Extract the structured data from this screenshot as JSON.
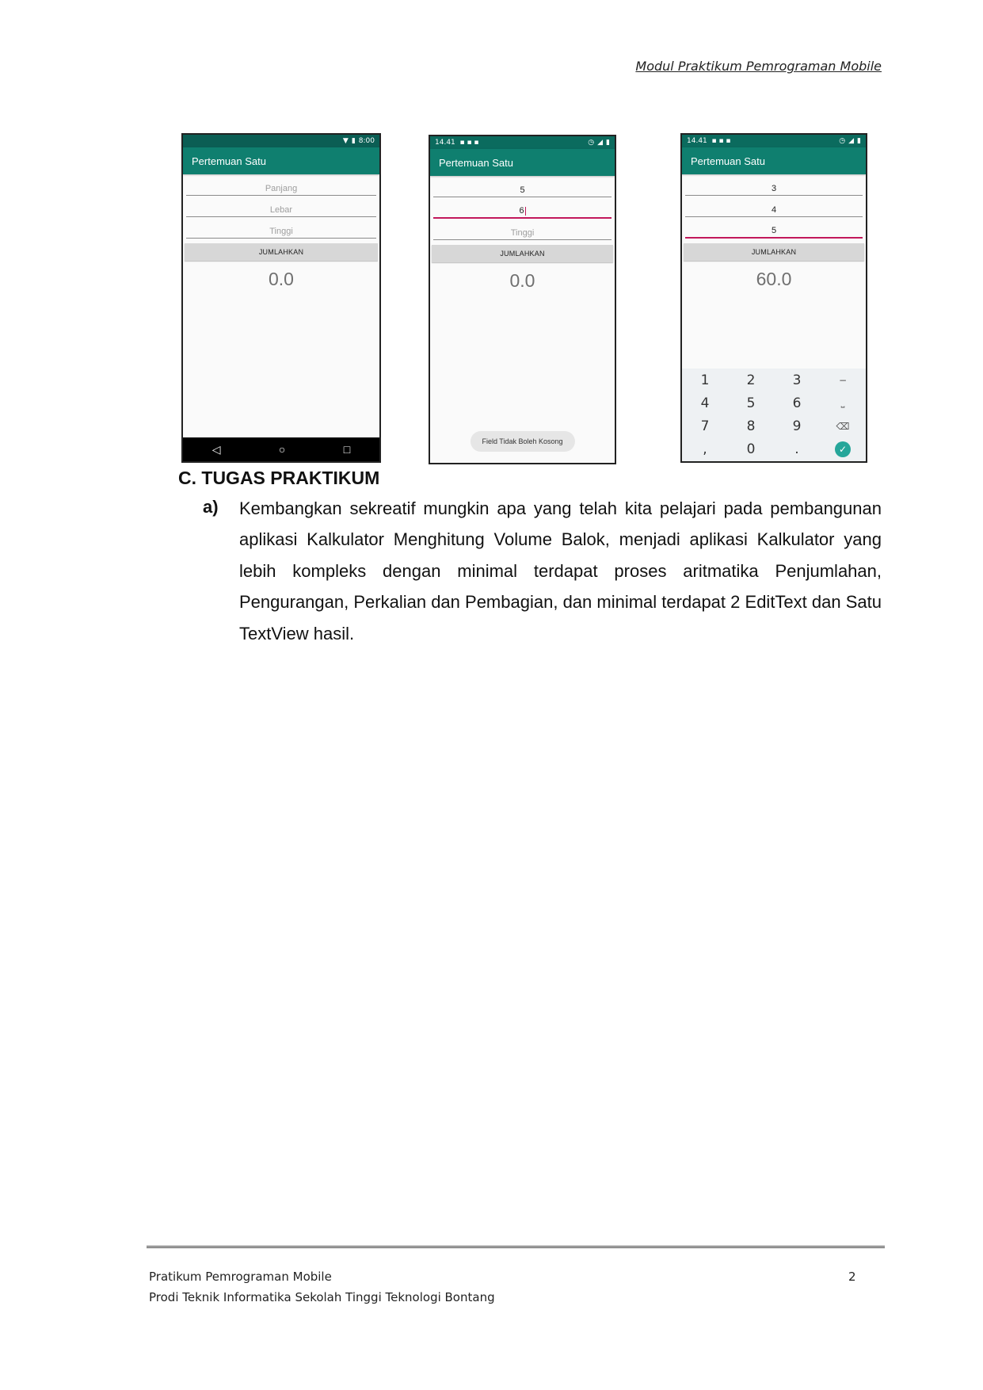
{
  "header": {
    "title": "Modul Praktikum Pemrograman Mobile"
  },
  "phones": [
    {
      "status_time": "8:00",
      "app_title": "Pertemuan Satu",
      "fields": [
        "Panjang",
        "Lebar",
        "Tinggi"
      ],
      "button": "JUMLAHKAN",
      "result": "0.0",
      "nav": {
        "back": "◁",
        "home": "○",
        "recent": "□"
      }
    },
    {
      "status_time": "14.41",
      "app_title": "Pertemuan Satu",
      "fields": [
        "5",
        "6",
        "Tinggi"
      ],
      "button": "JUMLAHKAN",
      "result": "0.0",
      "toast": "Field Tidak Boleh Kosong"
    },
    {
      "status_time": "14.41",
      "app_title": "Pertemuan Satu",
      "fields": [
        "3",
        "4",
        "5"
      ],
      "button": "JUMLAHKAN",
      "result": "60.0",
      "keys": [
        "1",
        "2",
        "3",
        "−",
        "4",
        "5",
        "6",
        "⎵",
        "7",
        "8",
        "9",
        "⌫",
        ",",
        "0",
        ".",
        "✓"
      ]
    }
  ],
  "section": {
    "heading": "C. TUGAS PRAKTIKUM",
    "items": [
      {
        "label": "a)",
        "text": "Kembangkan sekreatif mungkin apa yang telah kita pelajari pada pembangunan aplikasi Kalkulator Menghitung Volume Balok, menjadi aplikasi Kalkulator yang lebih kompleks dengan minimal terdapat proses aritmatika Penjumlahan, Pengurangan, Perkalian dan Pembagian, dan minimal terdapat 2 EditText dan Satu TextView hasil."
      }
    ]
  },
  "footer": {
    "line1": "Pratikum Pemrograman Mobile",
    "line2": "Prodi Teknik Informatika Sekolah Tinggi Teknologi Bontang",
    "page": "2"
  }
}
